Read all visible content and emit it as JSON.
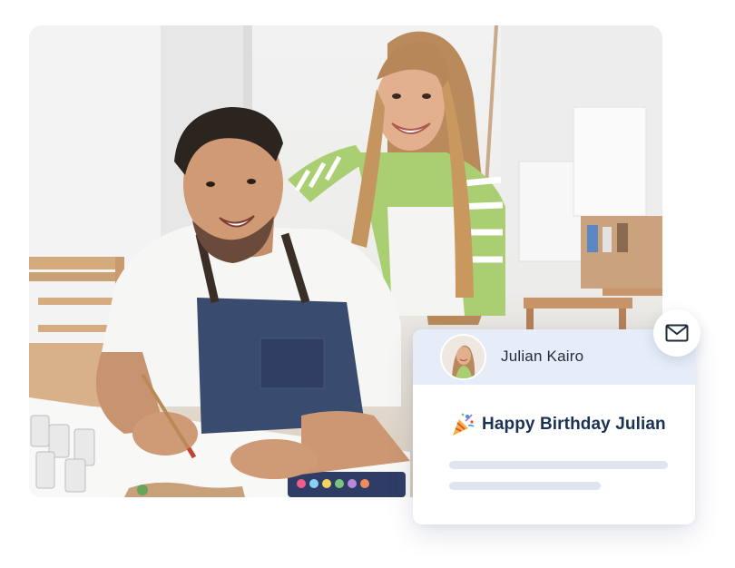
{
  "card": {
    "recipient_name": "Julian Kairo",
    "message": "Happy Birthday Julian"
  },
  "icons": {
    "mail": "envelope-icon",
    "party": "party-popper-icon"
  },
  "colors": {
    "card_header_bg": "#e6edf8",
    "message_text": "#1c3255",
    "placeholder_line": "#dfe5ef"
  }
}
